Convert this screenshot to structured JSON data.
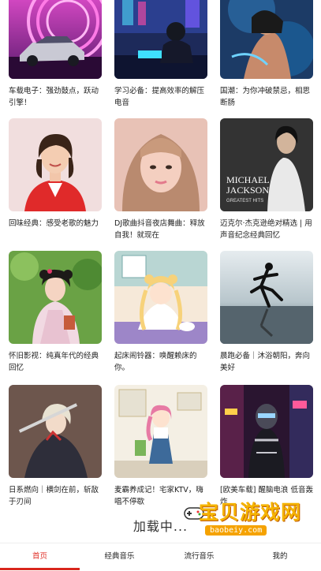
{
  "grid": {
    "items": [
      {
        "title": "车载电子：强劲鼓点，跃动引擎！",
        "cover_icon": "car-neon-cover"
      },
      {
        "title": "学习必备：提高效率的解压电音",
        "cover_icon": "study-girl-cover"
      },
      {
        "title": "国潮：为你冲破禁忌，相思断肠",
        "cover_icon": "guochao-cover"
      },
      {
        "title": "回味经典：感受老歌的魅力",
        "cover_icon": "woman-portrait-cover"
      },
      {
        "title": "DJ歌曲抖音夜店舞曲：释放自我！就现在",
        "cover_icon": "girl-portrait-cover"
      },
      {
        "title": "迈克尔·杰克逊绝对精选 | 用声音纪念经典回忆",
        "cover_icon": "michael-jackson-cover"
      },
      {
        "title": "怀旧影视：纯真年代的经典回忆",
        "cover_icon": "costume-drama-cover"
      },
      {
        "title": "起床闹铃器：唤醒赖床的你。",
        "cover_icon": "sailor-anime-cover"
      },
      {
        "title": "晨跑必备｜沐浴朝阳，奔向美好",
        "cover_icon": "runner-cover"
      },
      {
        "title": "日系燃向｜横剑在前，斩敌于刃间",
        "cover_icon": "swordswoman-cover"
      },
      {
        "title": "麦霸养成记！宅家KTV，嗨唱不停歇",
        "cover_icon": "singing-girl-cover"
      },
      {
        "title": "[欧美车载] 醒脑电浪 低音轰炸",
        "cover_icon": "cyber-rider-cover"
      }
    ],
    "michael_cover_text": [
      "MICHAEL",
      "JACKSON",
      "GREATEST HITS"
    ]
  },
  "loading": {
    "label": "加载中..."
  },
  "tabbar": {
    "tabs": [
      {
        "label": "首页",
        "active": true
      },
      {
        "label": "经典音乐",
        "active": false
      },
      {
        "label": "流行音乐",
        "active": false
      },
      {
        "label": "我的",
        "active": false
      }
    ],
    "accent_color": "#d9261c"
  },
  "watermark": {
    "title": "宝贝游戏网",
    "url": "baobeiy.com"
  }
}
